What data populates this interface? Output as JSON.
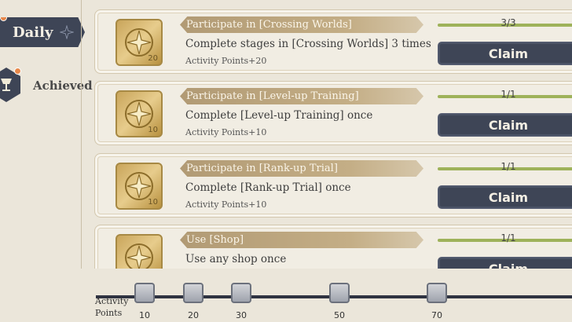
{
  "tabs": {
    "daily": "Daily",
    "achieved": "Achieved"
  },
  "tasks": [
    {
      "title": "Participate in [Crossing Worlds]",
      "description": "Complete stages in [Crossing Worlds] 3 times",
      "points": "Activity Points+20",
      "icon_number": "20",
      "progress": "3/3",
      "progress_fraction": 1,
      "button": "Claim"
    },
    {
      "title": "Participate in [Level-up Training]",
      "description": "Complete [Level-up Training] once",
      "points": "Activity Points+10",
      "icon_number": "10",
      "progress": "1/1",
      "progress_fraction": 1,
      "button": "Claim"
    },
    {
      "title": "Participate in [Rank-up Trial]",
      "description": "Complete [Rank-up Trial] once",
      "points": "Activity Points+10",
      "icon_number": "10",
      "progress": "1/1",
      "progress_fraction": 1,
      "button": "Claim"
    },
    {
      "title": "Use [Shop]",
      "description": "Use any shop once",
      "points": "",
      "icon_number": "",
      "progress": "1/1",
      "progress_fraction": 1,
      "button": "Claim"
    }
  ],
  "activity": {
    "label_line1": "Activity",
    "label_line2": "Points",
    "milestones": [
      "10",
      "20",
      "30",
      "50",
      "70"
    ]
  },
  "colors": {
    "background": "#ebe6da",
    "tab_dark": "#3e4556",
    "progress_green": "#9eb25a",
    "title_bar": "#b19a74",
    "notification": "#e8884a"
  },
  "icons": {
    "daily_tab": "compass-star-icon",
    "achieved_tab": "trophy-cup-icon",
    "task": "star-badge-icon",
    "milestone": "gift-chest-icon"
  }
}
